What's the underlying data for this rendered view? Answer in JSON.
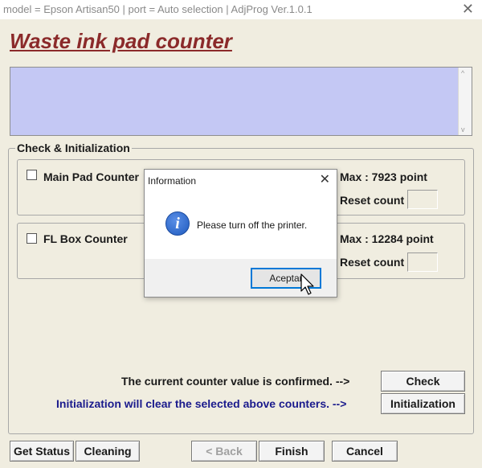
{
  "window": {
    "title": "model = Epson Artisan50 | port = Auto selection | AdjProg Ver.1.0.1",
    "close_glyph": "✕"
  },
  "heading": "Waste ink pad counter",
  "log": {
    "scroll_up_glyph": "^",
    "scroll_down_glyph": "v"
  },
  "group": {
    "legend": "Check & Initialization",
    "main_pad": {
      "label": "Main Pad Counter",
      "max": "Max : 7923 point",
      "reset_label": "Reset count",
      "checked": false
    },
    "fl_box": {
      "label": "FL Box Counter",
      "max": "Max : 12284 point",
      "reset_label": "Reset count",
      "checked": false
    },
    "check_message": "The current counter value is confirmed. -->",
    "check_button": "Check",
    "init_message": "Initialization will clear the selected above counters. -->",
    "init_button": "Initialization",
    "init_message_color": "#1a1a8c"
  },
  "footer": {
    "get_status": "Get Status",
    "cleaning": "Cleaning",
    "back": "< Back",
    "finish": "Finish",
    "cancel": "Cancel"
  },
  "dialog": {
    "title": "Information",
    "close_glyph": "✕",
    "icon": "info-icon",
    "icon_glyph": "i",
    "message": "Please turn off the printer.",
    "ok_button": "Aceptar"
  },
  "colors": {
    "heading": "#8b2a2a",
    "log_background": "#c4c8f4",
    "window_background": "#f0ede0",
    "dialog_focus": "#0078d7"
  }
}
